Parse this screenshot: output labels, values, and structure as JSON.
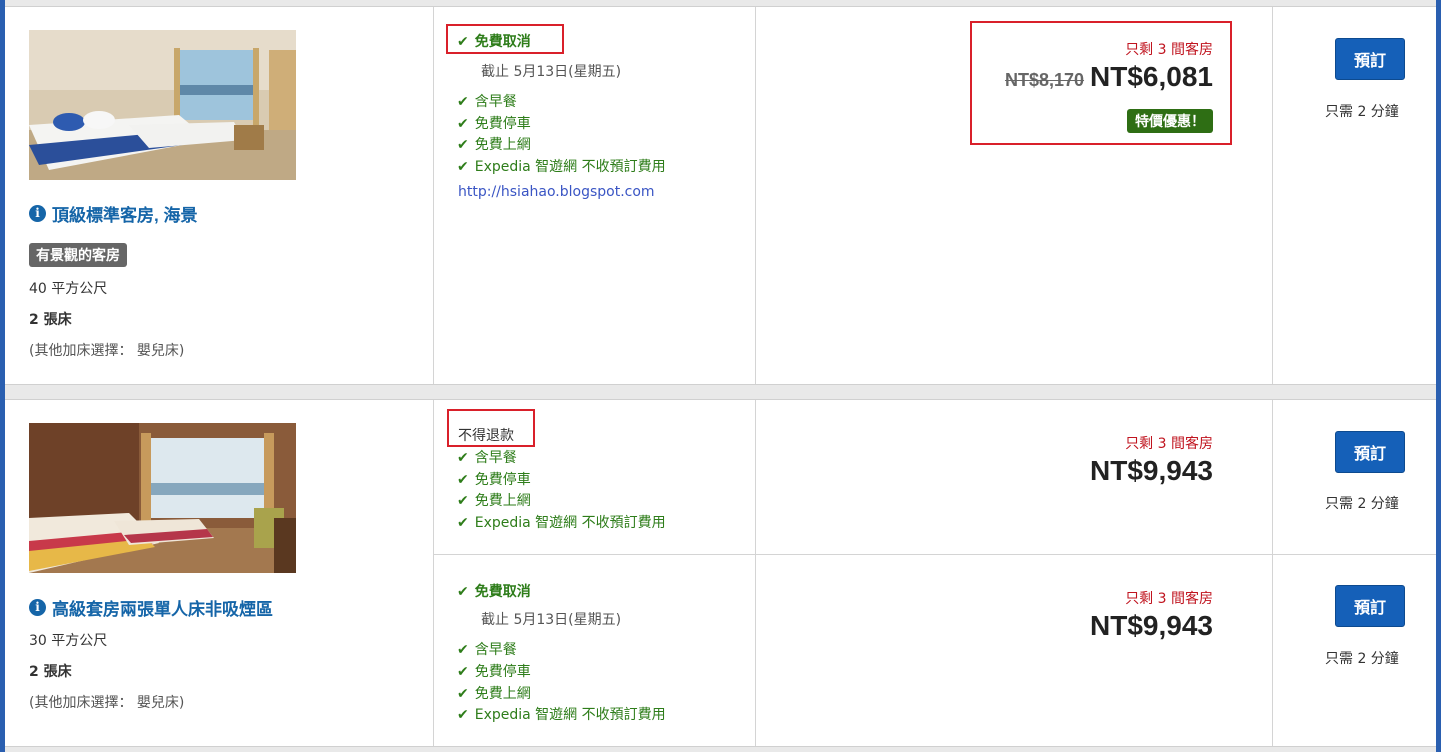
{
  "rooms": [
    {
      "name": "頂級標準客房, 海景",
      "view_badge": "有景觀的客房",
      "size": "40 平方公尺",
      "beds": "2 張床",
      "extra_beds": "(其他加床選擇： 嬰兒床)",
      "rates": [
        {
          "policy": "免費取消",
          "deadline": "截止 5月13日(星期五)",
          "amenities": [
            "含早餐",
            "免費停車",
            "免費上網",
            "Expedia 智遊網 不收預訂費用"
          ],
          "link": "http://hsiahao.blogspot.com",
          "rooms_left": "只剩 3 間客房",
          "old_price": "NT$8,170",
          "price": "NT$6,081",
          "deal": "特價優惠！",
          "book_label": "預訂",
          "book_time": "只需 2 分鐘"
        }
      ]
    },
    {
      "name": "高級套房兩張單人床非吸煙區",
      "size": "30 平方公尺",
      "beds": "2 張床",
      "extra_beds": "(其他加床選擇： 嬰兒床)",
      "rates": [
        {
          "policy": "不得退款",
          "amenities": [
            "含早餐",
            "免費停車",
            "免費上網",
            "Expedia 智遊網 不收預訂費用"
          ],
          "rooms_left": "只剩 3 間客房",
          "price": "NT$9,943",
          "book_label": "預訂",
          "book_time": "只需 2 分鐘"
        },
        {
          "policy": "免費取消",
          "deadline": "截止 5月13日(星期五)",
          "amenities": [
            "含早餐",
            "免費停車",
            "免費上網",
            "Expedia 智遊網 不收預訂費用"
          ],
          "rooms_left": "只剩 3 間客房",
          "price": "NT$9,943",
          "book_label": "預訂",
          "book_time": "只需 2 分鐘"
        }
      ]
    }
  ],
  "icons": {
    "check": "check-icon",
    "info": "info-icon"
  },
  "colors": {
    "accent": "#1565a8",
    "button": "#1560b8",
    "success": "#2e7d1a",
    "alert": "#c0141f",
    "highlight_box": "#d9202a",
    "frame": "#2a5fb0"
  }
}
